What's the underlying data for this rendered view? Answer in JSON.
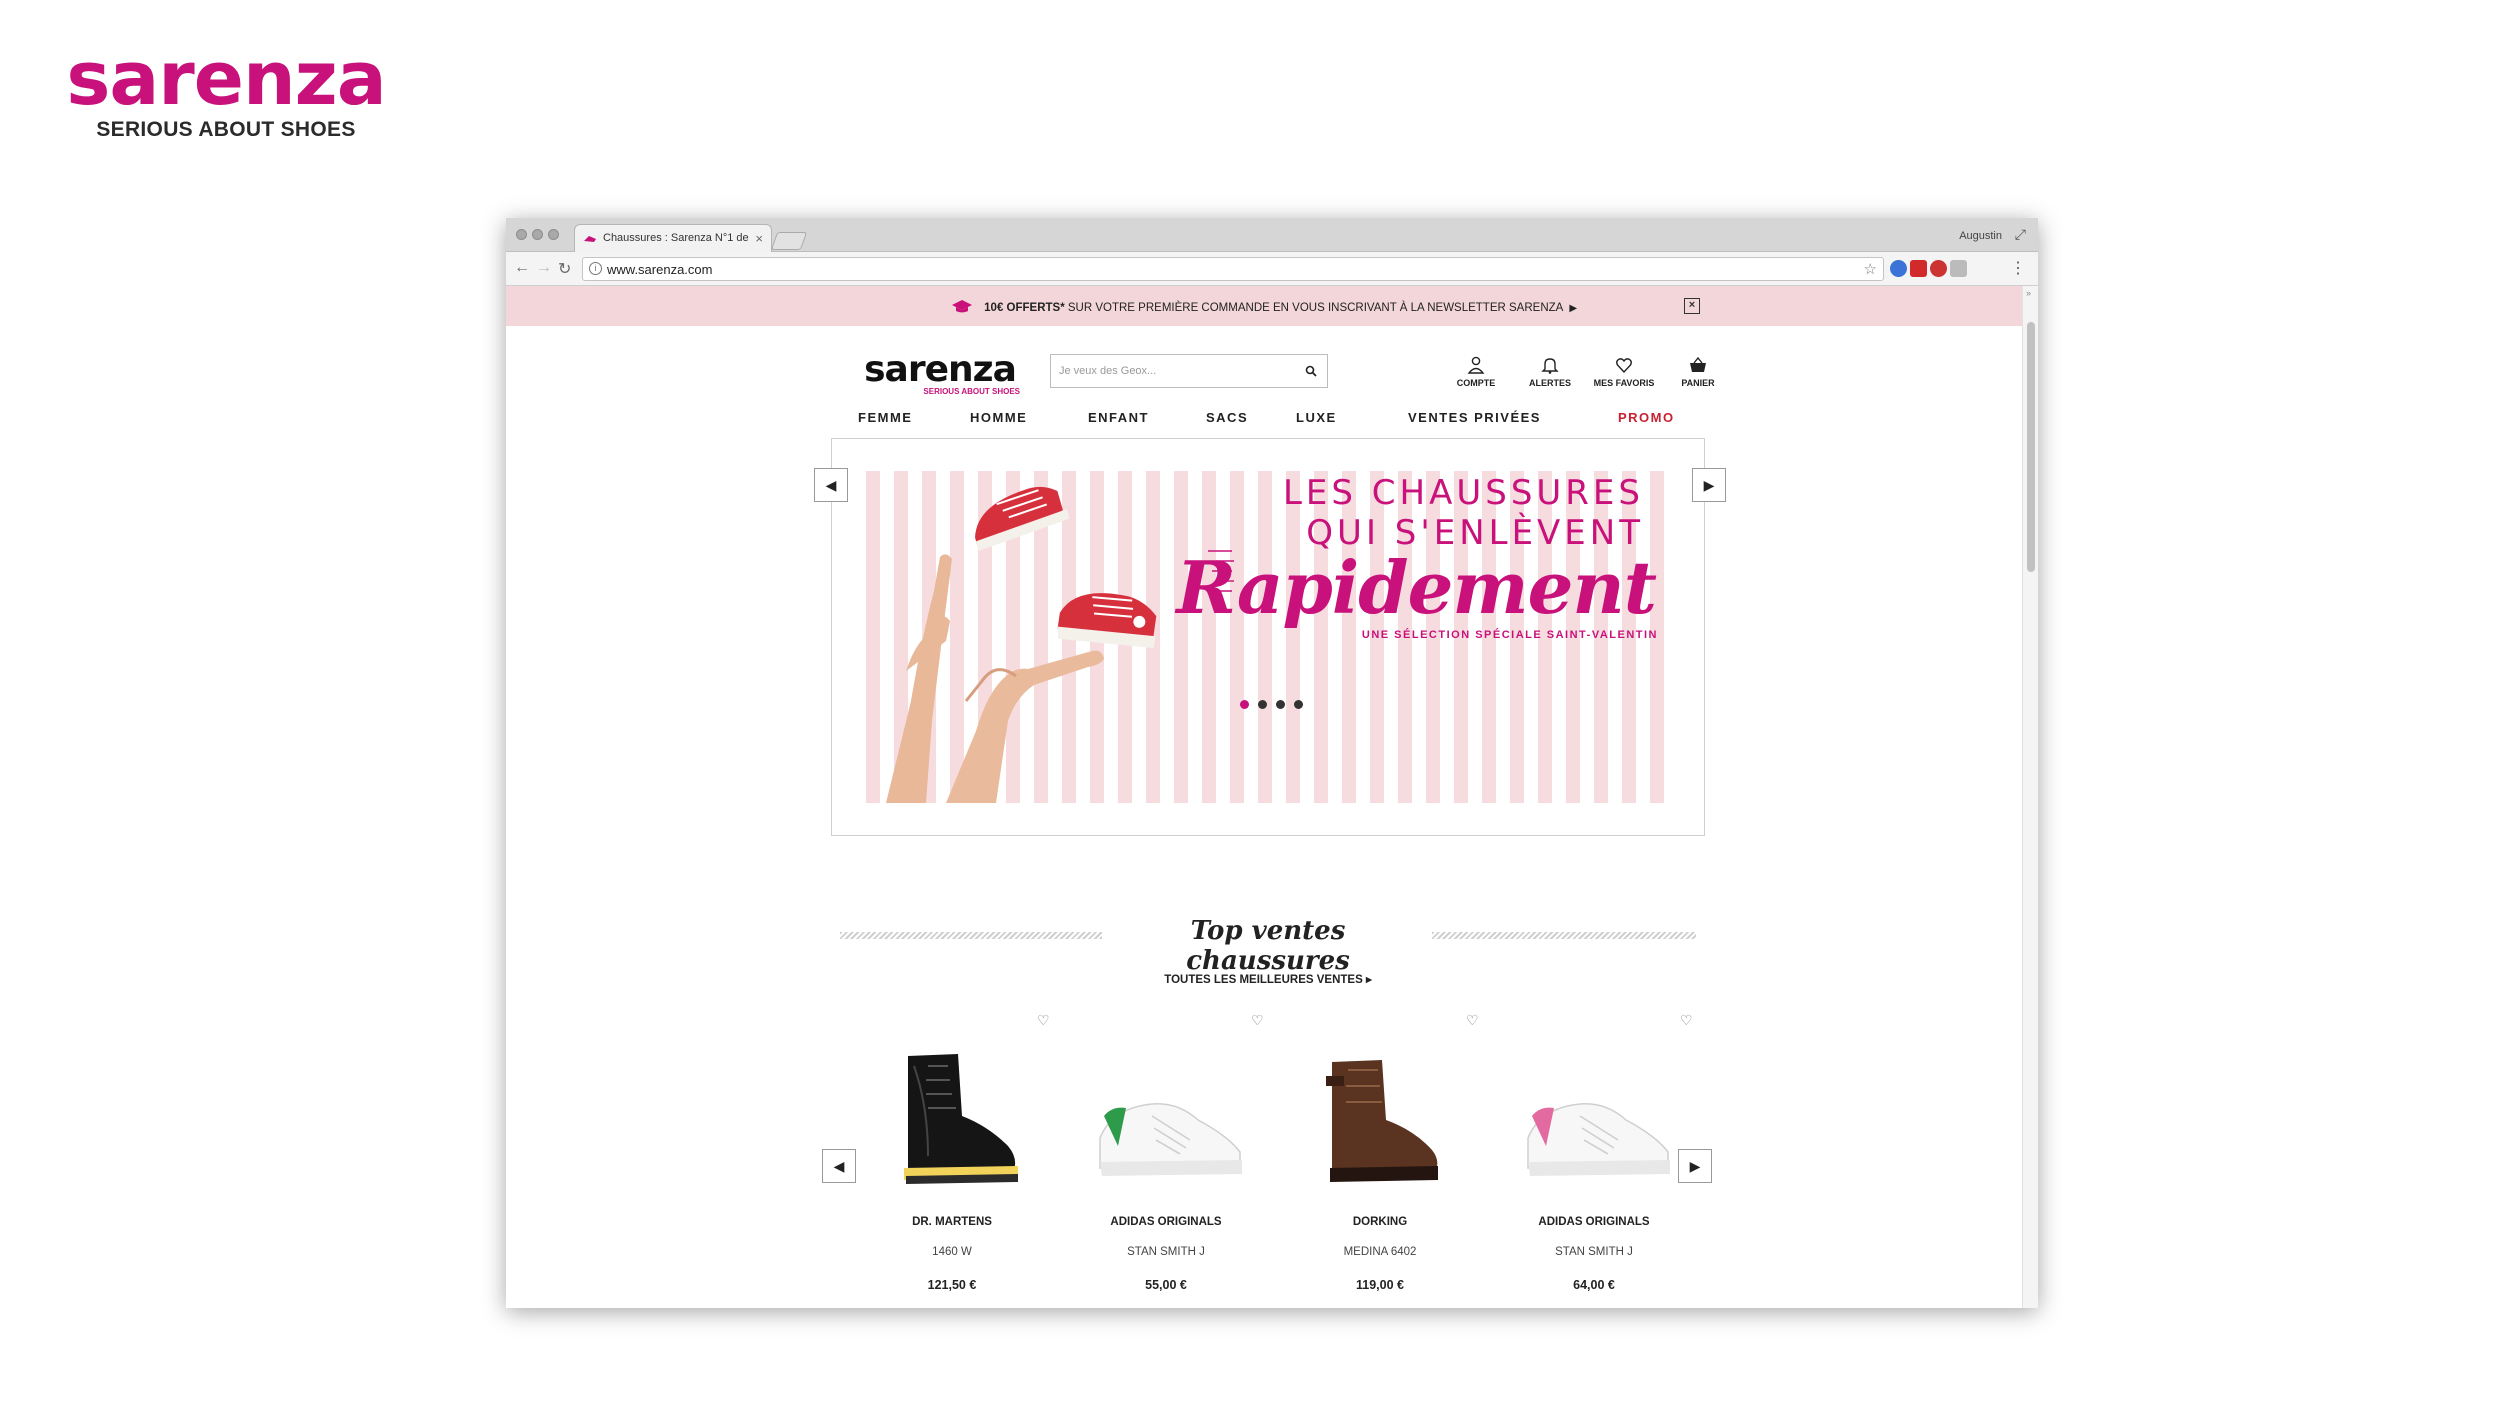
{
  "brand": {
    "name": "sarenza",
    "tagline": "SERIOUS ABOUT SHOES"
  },
  "browser": {
    "tab_title": "Chaussures : Sarenza N°1 de",
    "user": "Augustin",
    "url": "www.sarenza.com"
  },
  "newsletter_bar": {
    "offer": "10€ OFFERTS*",
    "text": " SUR VOTRE PREMIÈRE COMMANDE EN VOUS INSCRIVANT À LA NEWSLETTER SARENZA",
    "close": "×"
  },
  "header": {
    "logo": "sarenza",
    "logo_tagline": "SERIOUS ABOUT SHOES",
    "search_placeholder": "Je veux des Geox...",
    "account": "COMPTE",
    "alerts": "ALERTES",
    "favorites": "MES FAVORIS",
    "cart": "PANIER"
  },
  "nav": {
    "items": [
      "FEMME",
      "HOMME",
      "ENFANT",
      "SACS",
      "LUXE",
      "VENTES PRIVÉES"
    ],
    "promo": "PROMO"
  },
  "hero": {
    "line1": "LES CHAUSSURES",
    "line2": "QUI S'ENLÈVENT",
    "line3": "Rapidement",
    "line4": "UNE SÉLECTION SPÉCIALE SAINT-VALENTIN",
    "active_slide": 1,
    "slide_count": 4
  },
  "top_sales": {
    "title": "Top ventes chaussures",
    "link": "TOUTES LES MEILLEURES VENTES ▸",
    "products": [
      {
        "brand": "DR. MARTENS",
        "model": "1460 W",
        "price": "121,50 €"
      },
      {
        "brand": "ADIDAS ORIGINALS",
        "model": "STAN SMITH J",
        "price": "55,00 €"
      },
      {
        "brand": "DORKING",
        "model": "MEDINA 6402",
        "price": "119,00 €"
      },
      {
        "brand": "ADIDAS ORIGINALS",
        "model": "STAN SMITH J",
        "price": "64,00 €"
      }
    ]
  },
  "colors": {
    "brand_pink": "#c8117a",
    "promo_red": "#c8212f",
    "banner_pink": "#f3d6d9"
  }
}
